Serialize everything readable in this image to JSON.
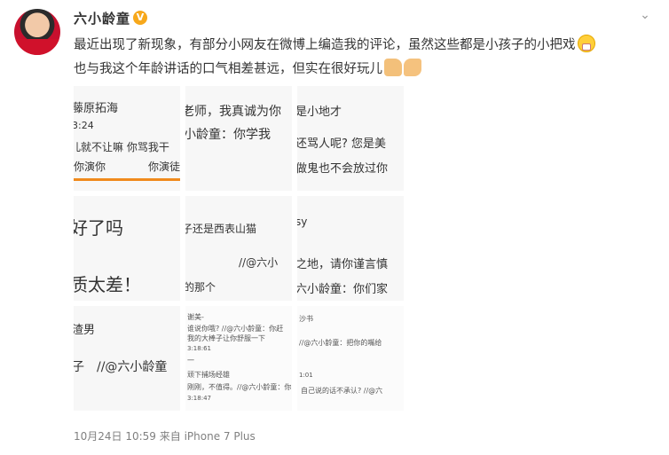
{
  "post": {
    "username": "六小龄童",
    "verified_badge": "V",
    "text_line1": "最近出现了新现象，有部分小网友在微博上编造我的评论，虽然这些都是小孩子的小把戏",
    "text_line2": "也与我这个年龄讲话的口气相差甚远，但实在很好玩儿",
    "footer": "10月24日 10:59 来自 iPhone 7 Plus"
  },
  "tiles": {
    "t1": {
      "l1": "藤原拓海",
      "l2": "3:24",
      "l3": "儿就不让嘛 你骂我干",
      "l4": ":你演你",
      "l5": "你演徒"
    },
    "t2": {
      "l1": "老师，我真诚为你",
      "l2": "小龄童：你学我"
    },
    "t3": {
      "l1": "是小地才",
      "l2": "还骂人呢? 您是美",
      "l3": "做鬼也不会放过你"
    },
    "t4": {
      "l1": "好了吗",
      "l2": "质太差！"
    },
    "t5": {
      "l1": "子还是西表山猫",
      "l2": "//@六小",
      "l3": "的那个"
    },
    "t6": {
      "l1": "sy",
      "l2": "之地，请你谨言慎",
      "l3": "六小龄童：你们家"
    },
    "t7": {
      "l1": "渣男",
      "l2": "子",
      "l3": "//@六小龄童"
    },
    "t8": {
      "l1": "谢美-",
      "l2": "谁说你哦? //@六小龄童：你赶",
      "l3": "我的大棒子让你舒服一下",
      "l4": "3:18:61",
      "l5": "一",
      "l6": "顽下捕场经雄",
      "l7": "刚刚，不值得。//@六小龄童：你",
      "l8": "3:18:47"
    },
    "t9": {
      "l1": "沙书",
      "l2": "//@六小龄童：把你的嘴给",
      "l3": "自己说的话不承认? //@六",
      "l4": "1:01"
    }
  },
  "icons": [
    "avatar",
    "verified-badge-icon",
    "chevron-down-icon",
    "grin-emoji-icon",
    "thumbs-up-emoji-icon",
    "handshake-emoji-icon"
  ],
  "colors": {
    "link": "#5b7fd1",
    "badge": "#f7a81b",
    "meta": "#808080"
  }
}
